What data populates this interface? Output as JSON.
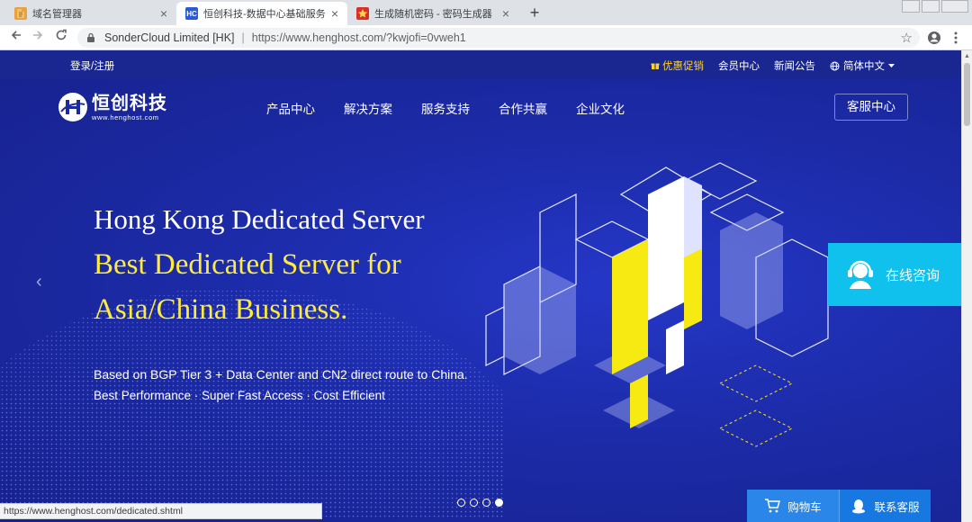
{
  "browser": {
    "tabs": [
      {
        "title": "域名管理器",
        "close": "×"
      },
      {
        "title": "恒创科技-数据中心基础服务商,云",
        "close": "×",
        "favicon_text": "HC"
      },
      {
        "title": "生成随机密码 - 密码生成器",
        "close": "×"
      }
    ],
    "new_tab": "+",
    "omnibox": {
      "org": "SonderCloud Limited [HK]",
      "divider": "|",
      "url": "https://www.henghost.com/?kwjofi=0vweh1"
    },
    "status_url": "https://www.henghost.com/dedicated.shtml"
  },
  "site": {
    "topbar": {
      "login": "登录/注册",
      "promo": "优惠促销",
      "member": "会员中心",
      "news": "新闻公告",
      "lang": "简体中文"
    },
    "logo": {
      "cn": "恒创科技",
      "en": "www.henghost.com"
    },
    "menu": [
      "产品中心",
      "解决方案",
      "服务支持",
      "合作共赢",
      "企业文化"
    ],
    "service_center": "客服中心",
    "hero": {
      "line1": "Hong Kong Dedicated Server",
      "line2": "Best Dedicated Server for",
      "line3": "Asia/China Business.",
      "sub1": "Based on BGP Tier 3 + Data Center and CN2 direct route to China.",
      "sub2": "Best Performance · Super Fast Access · Cost Efficient"
    },
    "consult": "在线咨询",
    "cart": "购物车",
    "contact": "联系客服",
    "slides": {
      "count": 4,
      "active": 4
    }
  },
  "colors": {
    "hero_bg": "#1c2a9c",
    "accent_yellow": "#ffec3a",
    "consult_bg": "#10c1ee",
    "cart_bg": "#2a86e8"
  }
}
